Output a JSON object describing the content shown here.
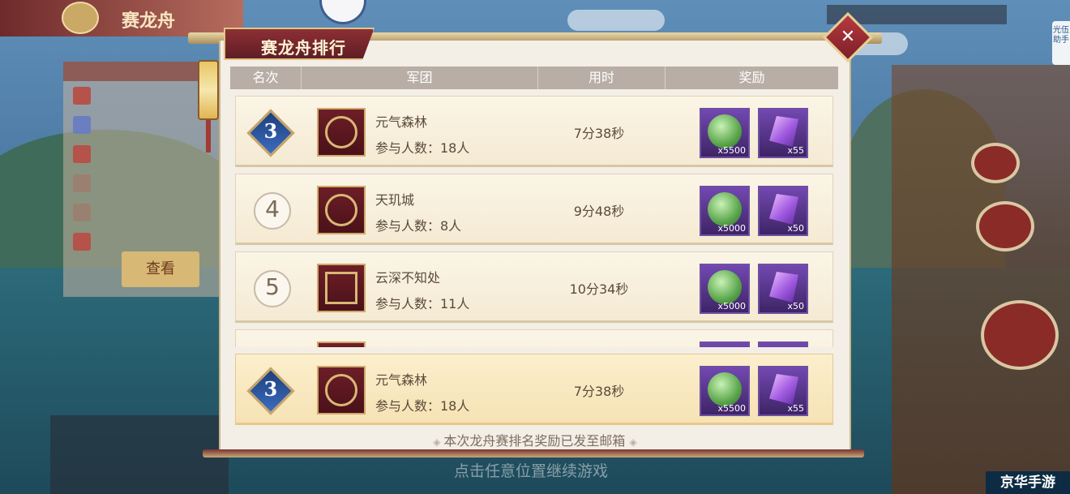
{
  "background": {
    "top_tab_title": "赛龙舟",
    "continue_hint": "点击任意位置继续游戏",
    "side_button": "查看",
    "assistant_label": "光伍助手",
    "watermark": "京华手游"
  },
  "dialog": {
    "title": "赛龙舟排行",
    "close_icon": "close-x-icon",
    "columns": {
      "rank": "名次",
      "team": "军团",
      "time": "用时",
      "reward": "奖励"
    },
    "rows": [
      {
        "rank": "3",
        "rank_style": "badge",
        "team_name": "元气森林",
        "members": "参与人数：18人",
        "time": "7分38秒",
        "reward1_count": "x5500",
        "reward2_count": "x55"
      },
      {
        "rank": "4",
        "rank_style": "ring",
        "team_name": "天玑城",
        "members": "参与人数：8人",
        "time": "9分48秒",
        "reward1_count": "x5000",
        "reward2_count": "x50"
      },
      {
        "rank": "5",
        "rank_style": "ring",
        "team_name": "云深不知处",
        "members": "参与人数：11人",
        "time": "10分34秒",
        "reward1_count": "x5000",
        "reward2_count": "x50"
      }
    ],
    "my_row": {
      "rank": "3",
      "team_name": "元气森林",
      "members": "参与人数：18人",
      "time": "7分38秒",
      "reward1_count": "x5500",
      "reward2_count": "x55"
    },
    "footer_note": "本次龙舟赛排名奖励已发至邮箱"
  },
  "colors": {
    "title_tab": "#7a2730",
    "header_bar": "#b8aea6",
    "row_bg": "#fbf5e6",
    "reward_frame": "#6e4fa3"
  }
}
